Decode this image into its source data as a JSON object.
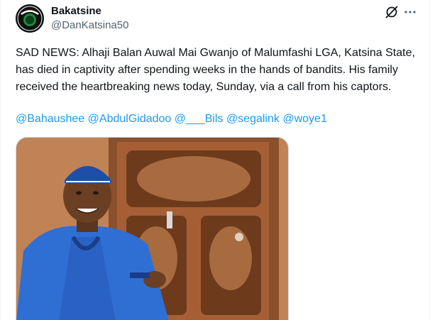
{
  "author": {
    "name": "Bakatsine",
    "handle": "@DanKatsina50",
    "avatar_text": "BAKATSINE"
  },
  "tweet": {
    "text": "SAD NEWS: Alhaji Balan Auwal Mai Gwanjo of Malumfashi LGA, Katsina State, has died in captivity after spending weeks in the hands of bandits. His family received the heartbreaking news today, Sunday, via a call from his captors.",
    "mentions": [
      "@Bahaushee",
      "@AbdulGidadoo",
      "@___Bils",
      "@segalink",
      "@woye1"
    ]
  },
  "icons": {
    "grok": "grok-icon",
    "more": "more-horizontal-icon"
  },
  "colors": {
    "link": "#1d9bf0",
    "secondary_text": "#536471",
    "primary_text": "#0f1419"
  }
}
